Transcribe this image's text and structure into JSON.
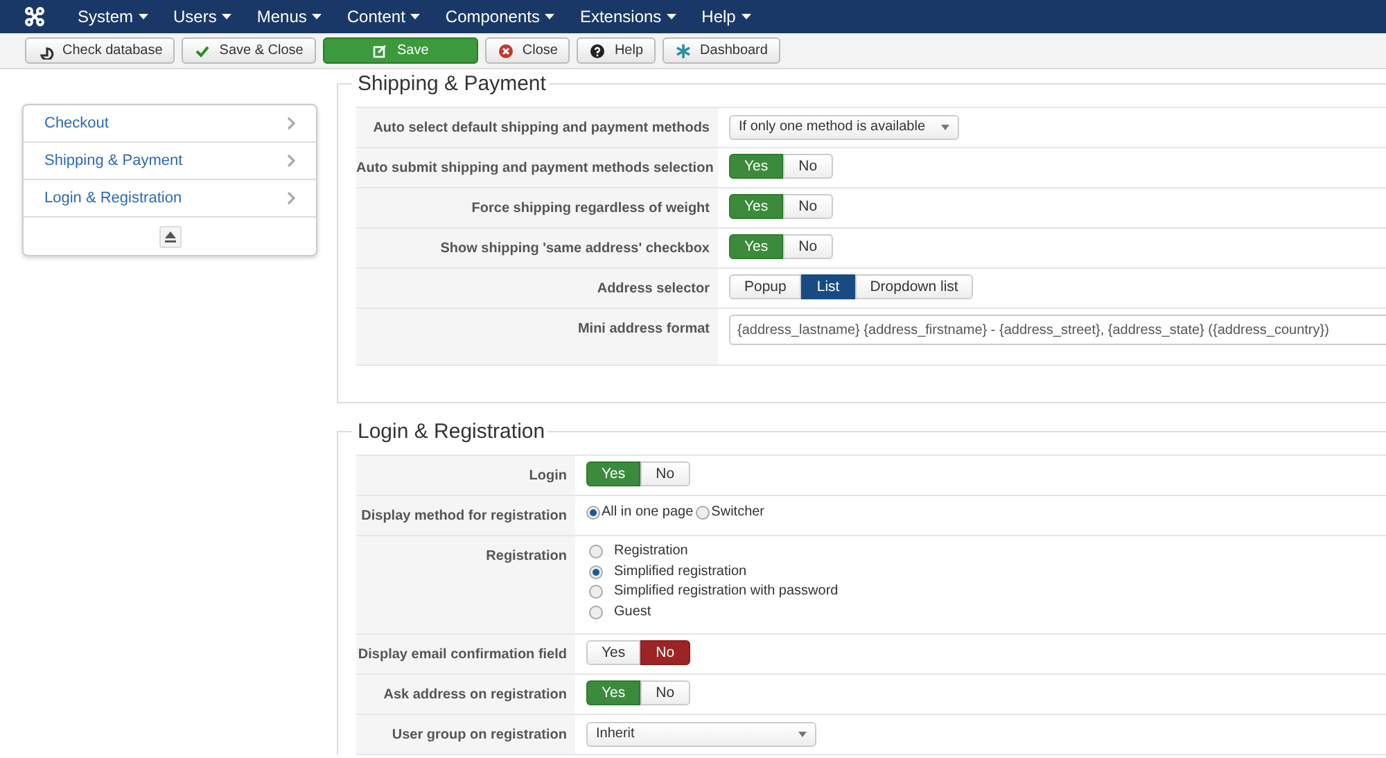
{
  "menu": [
    {
      "label": "System"
    },
    {
      "label": "Users"
    },
    {
      "label": "Menus"
    },
    {
      "label": "Content"
    },
    {
      "label": "Components"
    },
    {
      "label": "Extensions"
    },
    {
      "label": "Help"
    }
  ],
  "toolbar": [
    {
      "label": "Check database",
      "kind": "database"
    },
    {
      "label": "Save & Close",
      "kind": "check"
    },
    {
      "label": "Save",
      "kind": "save"
    },
    {
      "label": "Close",
      "kind": "close"
    },
    {
      "label": "Help",
      "kind": "help"
    },
    {
      "label": "Dashboard",
      "kind": "dashboard"
    }
  ],
  "sidebar": {
    "items": [
      {
        "label": "Checkout"
      },
      {
        "label": "Shipping & Payment"
      },
      {
        "label": "Login & Registration"
      }
    ]
  },
  "sections": [
    {
      "title": "Shipping & Payment",
      "fields": [
        {
          "label": "Auto select default shipping and payment methods",
          "kind": "select",
          "value": "If only one method is available"
        },
        {
          "label": "Auto submit shipping and payment methods selection",
          "kind": "toggle",
          "options": [
            {
              "label": "Yes",
              "selected": true
            },
            {
              "label": "No",
              "selected": false
            }
          ]
        },
        {
          "label": "Force shipping regardless of weight",
          "kind": "toggle",
          "options": [
            {
              "label": "Yes",
              "selected": true
            },
            {
              "label": "No",
              "selected": false
            }
          ]
        },
        {
          "label": "Show shipping 'same address' checkbox",
          "kind": "toggle",
          "options": [
            {
              "label": "Yes",
              "selected": true
            },
            {
              "label": "No",
              "selected": false
            }
          ]
        },
        {
          "label": "Address selector",
          "kind": "toggle",
          "options": [
            {
              "label": "Popup",
              "selected": false
            },
            {
              "label": "List",
              "selected": true
            },
            {
              "label": "Dropdown list",
              "selected": false
            }
          ]
        },
        {
          "label": "Mini address format",
          "kind": "text",
          "value": "{address_lastname} {address_firstname} - {address_street}, {address_state} ({address_country})"
        }
      ]
    },
    {
      "title": "Login & Registration",
      "fields": [
        {
          "label": "Login",
          "kind": "toggle",
          "options": [
            {
              "label": "Yes",
              "selected": true
            },
            {
              "label": "No",
              "selected": false
            }
          ]
        },
        {
          "label": "Display method for registration",
          "kind": "radio_inline",
          "options": [
            {
              "label": "All in one page",
              "selected": true
            },
            {
              "label": "Switcher",
              "selected": false
            }
          ]
        },
        {
          "label": "Registration",
          "kind": "radio",
          "options": [
            {
              "label": "Registration",
              "selected": false
            },
            {
              "label": "Simplified registration",
              "selected": true
            },
            {
              "label": "Simplified registration with password",
              "selected": false
            },
            {
              "label": "Guest",
              "selected": false
            }
          ]
        },
        {
          "label": "Display email confirmation field",
          "kind": "toggle",
          "options": [
            {
              "label": "Yes",
              "selected": false
            },
            {
              "label": "No",
              "selected": true
            }
          ]
        },
        {
          "label": "Ask address on registration",
          "kind": "toggle",
          "options": [
            {
              "label": "Yes",
              "selected": true
            },
            {
              "label": "No",
              "selected": false
            }
          ]
        },
        {
          "label": "User group on registration",
          "kind": "select",
          "value": "Inherit"
        }
      ]
    }
  ]
}
